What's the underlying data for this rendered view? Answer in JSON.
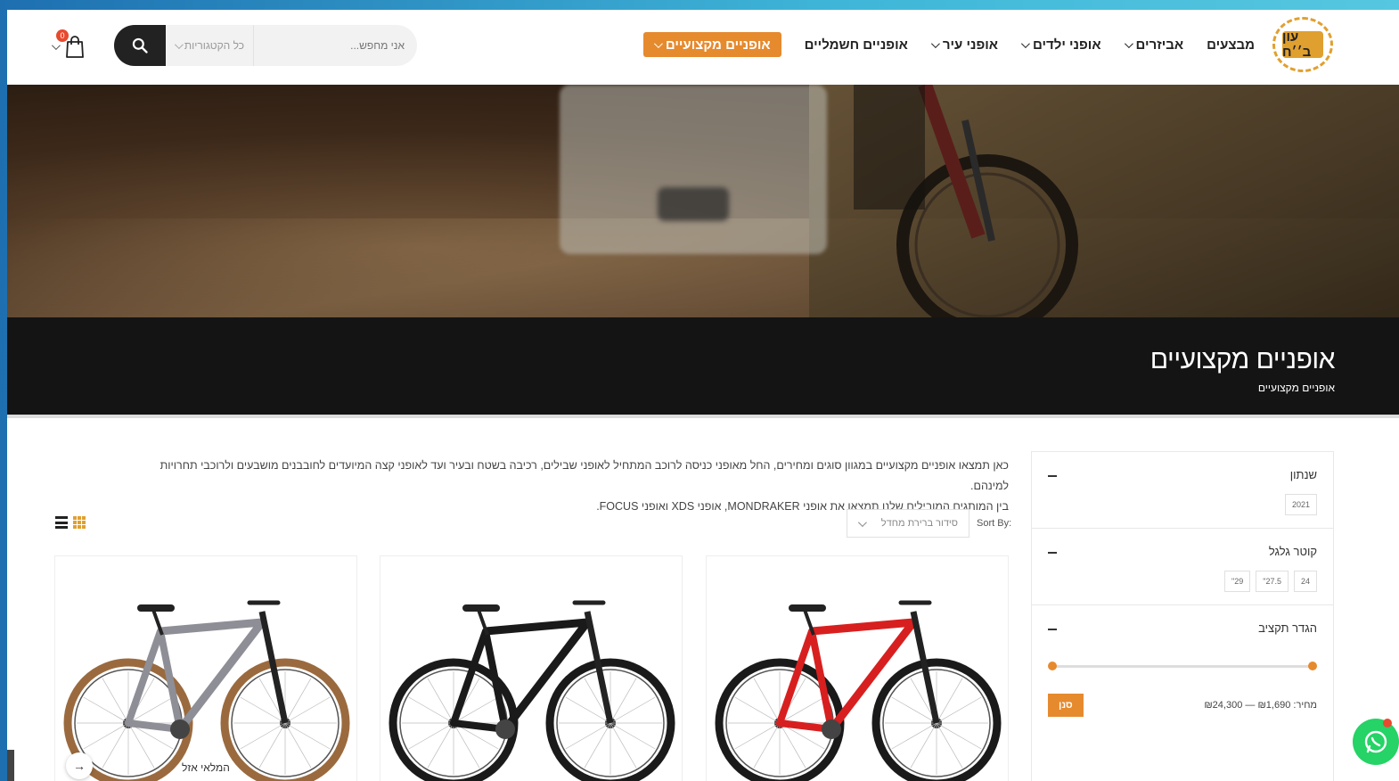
{
  "header": {
    "logo_text": "עון ב׳׳ח",
    "nav": [
      {
        "label": "אופניים מקצועיים",
        "dropdown": true,
        "active": true
      },
      {
        "label": "אופניים חשמליים",
        "dropdown": false,
        "active": false
      },
      {
        "label": "אופני עיר",
        "dropdown": true,
        "active": false
      },
      {
        "label": "אופני ילדים",
        "dropdown": true,
        "active": false
      },
      {
        "label": "אביזרים",
        "dropdown": true,
        "active": false
      },
      {
        "label": "מבצעים",
        "dropdown": false,
        "active": false
      }
    ],
    "search": {
      "placeholder": "אני מחפש...",
      "category_label": "כל הקטגוריות"
    },
    "cart": {
      "count": "0"
    }
  },
  "title_band": {
    "title": "אופניים מקצועיים",
    "breadcrumb": "אופניים מקצועיים"
  },
  "sidebar": {
    "year": {
      "title": "שנתון",
      "chips": [
        "2021"
      ]
    },
    "wheel": {
      "title": "קוטר גלגל",
      "chips": [
        "24",
        "27.5\"",
        "29\""
      ]
    },
    "budget": {
      "title": "הגדר תקציב",
      "price_label": "מחיר: ₪1,690 — ₪24,300",
      "button": "סנן"
    }
  },
  "main": {
    "description_line1": "כאן תמצאו אופניים מקצועיים במגוון סוגים ומחירים, החל מאופני כניסה לרוכב המתחיל לאופני שבילים, רכיבה בשטח ובעיר ועד לאופני קצה המיועדים לחובבנים מושבעים ולרוכבי תחרויות למינהם.",
    "description_line2": "בין המותגים המובילים שלנו תמצאו את אופני MONDRAKER, אופני XDS ואופני FOCUS.",
    "sort_label": "Sort By:",
    "sort_value": "סידור ברירת מחדל"
  },
  "products": [
    {
      "color": "#d81f1f",
      "tire": "#1a1a1a",
      "stock_label": ""
    },
    {
      "color": "#1a1a1a",
      "tire": "#1a1a1a",
      "stock_label": ""
    },
    {
      "color": "#8e8e96",
      "tire": "#9a6a3e",
      "stock_label": "המלאי אזל"
    }
  ],
  "colors": {
    "accent": "#e68a2e",
    "dark": "#141414",
    "whatsapp": "#25d366"
  }
}
